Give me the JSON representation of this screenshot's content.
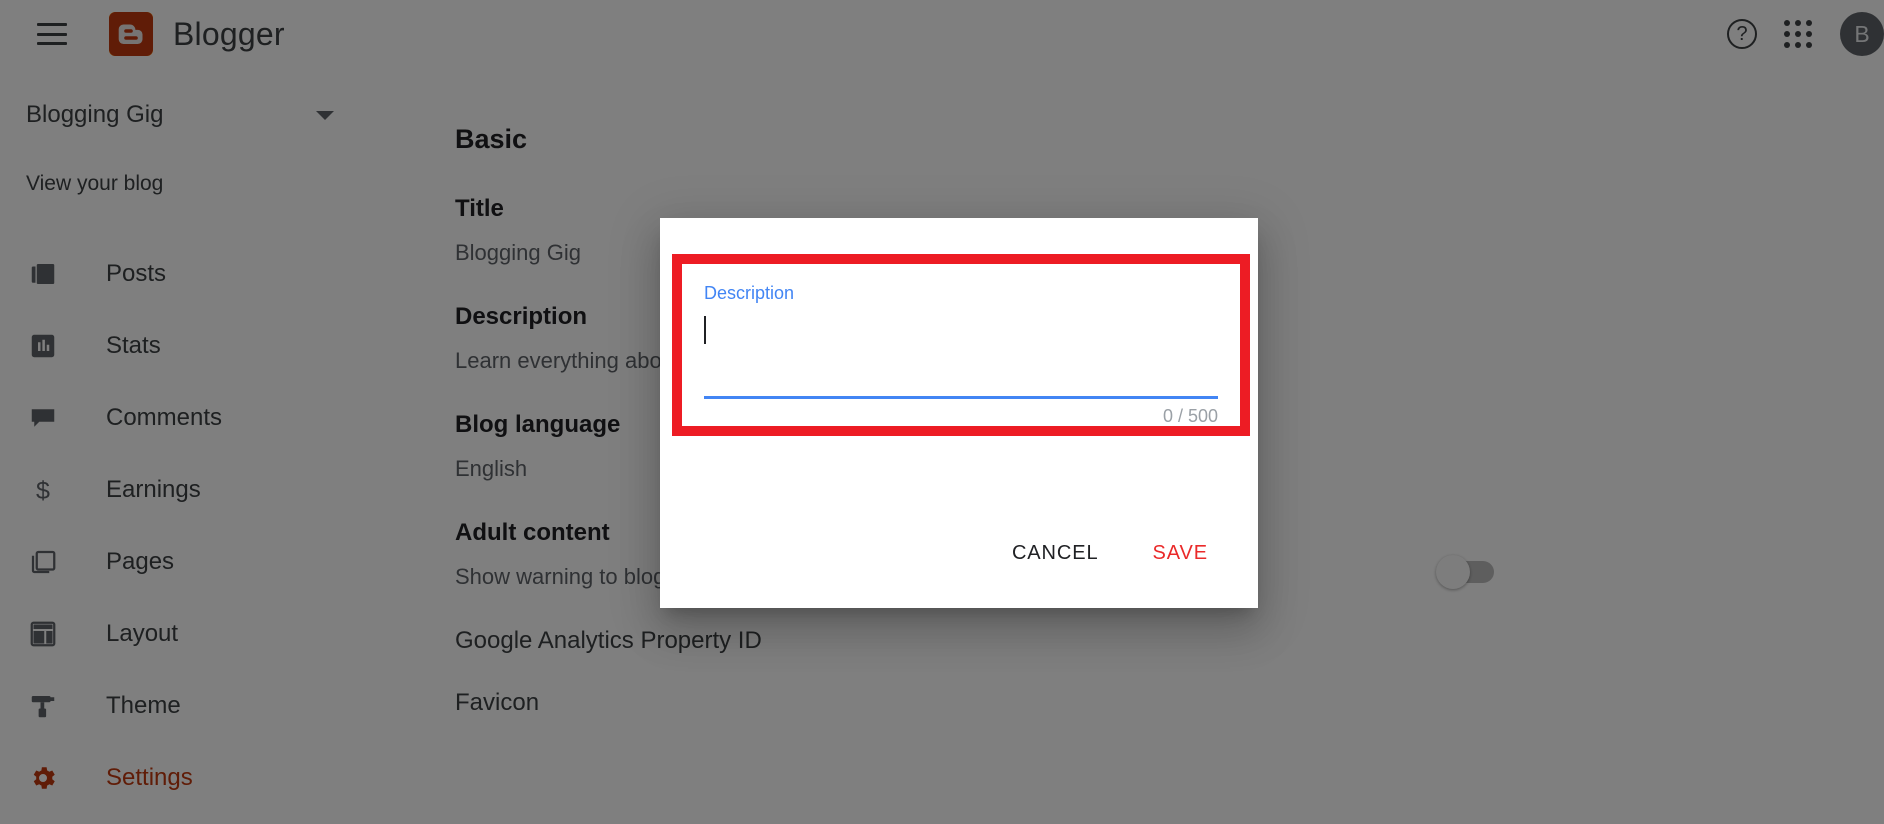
{
  "appbar": {
    "menu_icon": "hamburger-menu-icon",
    "logo_letter": "B",
    "brand": "Blogger",
    "help_icon": "help-circle-icon",
    "help_glyph": "?",
    "apps_icon": "apps-grid-icon",
    "avatar_letter": "B"
  },
  "sidebar": {
    "blog_name": "Blogging Gig",
    "blog_select_icon": "chevron-down-icon",
    "view_blog": "View your blog",
    "items": [
      {
        "label": "Posts",
        "icon": "posts-icon",
        "active": false
      },
      {
        "label": "Stats",
        "icon": "stats-icon",
        "active": false
      },
      {
        "label": "Comments",
        "icon": "comments-icon",
        "active": false
      },
      {
        "label": "Earnings",
        "icon": "earnings-icon",
        "active": false
      },
      {
        "label": "Pages",
        "icon": "pages-icon",
        "active": false
      },
      {
        "label": "Layout",
        "icon": "layout-icon",
        "active": false
      },
      {
        "label": "Theme",
        "icon": "theme-icon",
        "active": false
      },
      {
        "label": "Settings",
        "icon": "gear-icon",
        "active": true
      }
    ]
  },
  "content": {
    "section_title": "Basic",
    "fields": [
      {
        "label": "Title",
        "value": "Blogging Gig"
      },
      {
        "label": "Description",
        "value": "Learn everything about Blogging, Make money online, Affliate marketing"
      },
      {
        "label": "Blog language",
        "value": "English"
      },
      {
        "label": "Adult content",
        "value": "Show warning to blog readers"
      },
      {
        "label": "Google Analytics Property ID",
        "value": ""
      },
      {
        "label": "Favicon",
        "value": ""
      }
    ],
    "adult_content_toggle_state": "off"
  },
  "dialog": {
    "field_label": "Description",
    "field_value": "",
    "counter": "0 / 500",
    "max_length": 500,
    "cancel_label": "CANCEL",
    "save_label": "SAVE",
    "highlight_color": "#ED1C24",
    "accent_blue": "#4285F4",
    "save_color": "#EA2A2A"
  }
}
